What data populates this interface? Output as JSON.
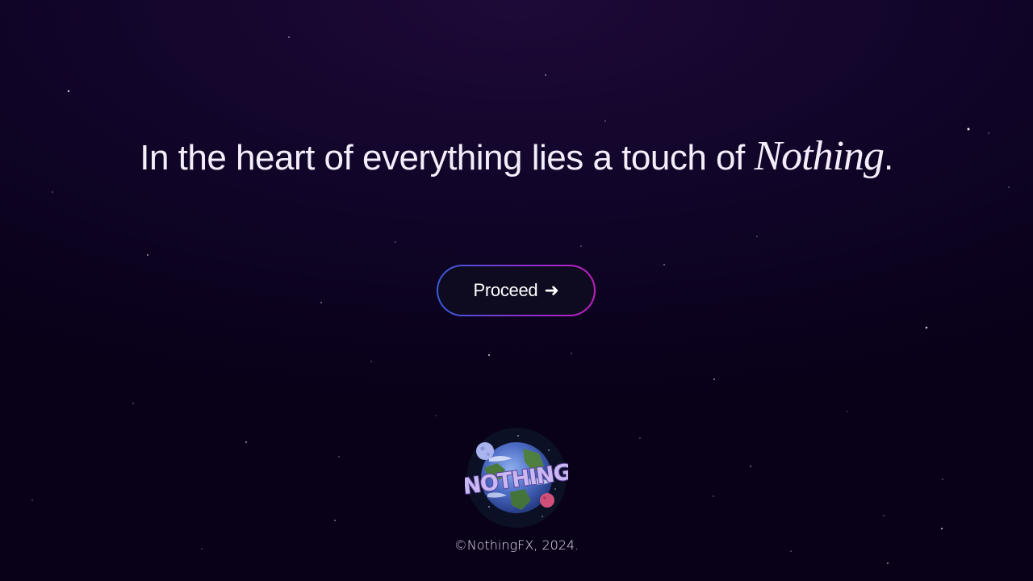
{
  "hero": {
    "headline_prefix": "In the heart of everything lies a touch of ",
    "headline_accent": "Nothing",
    "headline_suffix": "."
  },
  "cta": {
    "label": "Proceed",
    "icon": "arrow-right-icon",
    "arrow_glyph": "➜"
  },
  "logo": {
    "text": "NOTHING",
    "icon": "planet-logo-icon"
  },
  "footer": {
    "copyright": "©NothingFX, 2024."
  },
  "colors": {
    "background_top": "#1e0a38",
    "background_bottom": "#080118",
    "button_fill": "#0e0b20",
    "button_border_start": "#3a5bd8",
    "button_border_end": "#c21fc0",
    "text": "#f4eefb"
  }
}
